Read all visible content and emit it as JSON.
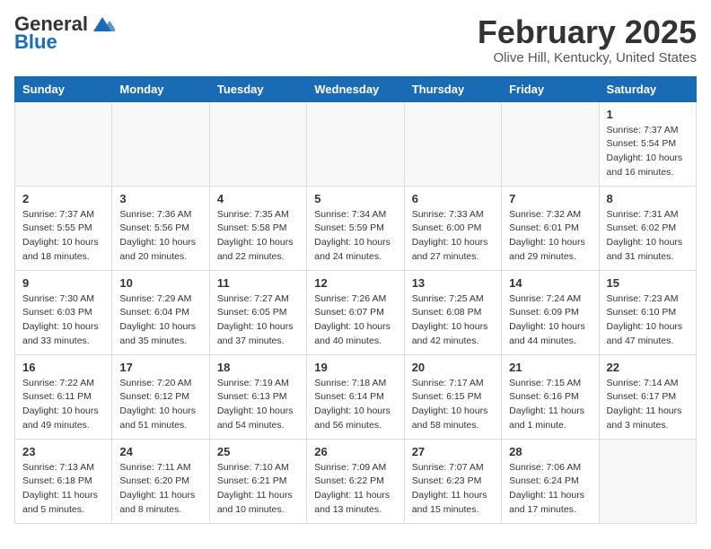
{
  "header": {
    "logo_general": "General",
    "logo_blue": "Blue",
    "month_title": "February 2025",
    "location": "Olive Hill, Kentucky, United States"
  },
  "days_of_week": [
    "Sunday",
    "Monday",
    "Tuesday",
    "Wednesday",
    "Thursday",
    "Friday",
    "Saturday"
  ],
  "weeks": [
    [
      {
        "day": "",
        "info": ""
      },
      {
        "day": "",
        "info": ""
      },
      {
        "day": "",
        "info": ""
      },
      {
        "day": "",
        "info": ""
      },
      {
        "day": "",
        "info": ""
      },
      {
        "day": "",
        "info": ""
      },
      {
        "day": "1",
        "info": "Sunrise: 7:37 AM\nSunset: 5:54 PM\nDaylight: 10 hours\nand 16 minutes."
      }
    ],
    [
      {
        "day": "2",
        "info": "Sunrise: 7:37 AM\nSunset: 5:55 PM\nDaylight: 10 hours\nand 18 minutes."
      },
      {
        "day": "3",
        "info": "Sunrise: 7:36 AM\nSunset: 5:56 PM\nDaylight: 10 hours\nand 20 minutes."
      },
      {
        "day": "4",
        "info": "Sunrise: 7:35 AM\nSunset: 5:58 PM\nDaylight: 10 hours\nand 22 minutes."
      },
      {
        "day": "5",
        "info": "Sunrise: 7:34 AM\nSunset: 5:59 PM\nDaylight: 10 hours\nand 24 minutes."
      },
      {
        "day": "6",
        "info": "Sunrise: 7:33 AM\nSunset: 6:00 PM\nDaylight: 10 hours\nand 27 minutes."
      },
      {
        "day": "7",
        "info": "Sunrise: 7:32 AM\nSunset: 6:01 PM\nDaylight: 10 hours\nand 29 minutes."
      },
      {
        "day": "8",
        "info": "Sunrise: 7:31 AM\nSunset: 6:02 PM\nDaylight: 10 hours\nand 31 minutes."
      }
    ],
    [
      {
        "day": "9",
        "info": "Sunrise: 7:30 AM\nSunset: 6:03 PM\nDaylight: 10 hours\nand 33 minutes."
      },
      {
        "day": "10",
        "info": "Sunrise: 7:29 AM\nSunset: 6:04 PM\nDaylight: 10 hours\nand 35 minutes."
      },
      {
        "day": "11",
        "info": "Sunrise: 7:27 AM\nSunset: 6:05 PM\nDaylight: 10 hours\nand 37 minutes."
      },
      {
        "day": "12",
        "info": "Sunrise: 7:26 AM\nSunset: 6:07 PM\nDaylight: 10 hours\nand 40 minutes."
      },
      {
        "day": "13",
        "info": "Sunrise: 7:25 AM\nSunset: 6:08 PM\nDaylight: 10 hours\nand 42 minutes."
      },
      {
        "day": "14",
        "info": "Sunrise: 7:24 AM\nSunset: 6:09 PM\nDaylight: 10 hours\nand 44 minutes."
      },
      {
        "day": "15",
        "info": "Sunrise: 7:23 AM\nSunset: 6:10 PM\nDaylight: 10 hours\nand 47 minutes."
      }
    ],
    [
      {
        "day": "16",
        "info": "Sunrise: 7:22 AM\nSunset: 6:11 PM\nDaylight: 10 hours\nand 49 minutes."
      },
      {
        "day": "17",
        "info": "Sunrise: 7:20 AM\nSunset: 6:12 PM\nDaylight: 10 hours\nand 51 minutes."
      },
      {
        "day": "18",
        "info": "Sunrise: 7:19 AM\nSunset: 6:13 PM\nDaylight: 10 hours\nand 54 minutes."
      },
      {
        "day": "19",
        "info": "Sunrise: 7:18 AM\nSunset: 6:14 PM\nDaylight: 10 hours\nand 56 minutes."
      },
      {
        "day": "20",
        "info": "Sunrise: 7:17 AM\nSunset: 6:15 PM\nDaylight: 10 hours\nand 58 minutes."
      },
      {
        "day": "21",
        "info": "Sunrise: 7:15 AM\nSunset: 6:16 PM\nDaylight: 11 hours\nand 1 minute."
      },
      {
        "day": "22",
        "info": "Sunrise: 7:14 AM\nSunset: 6:17 PM\nDaylight: 11 hours\nand 3 minutes."
      }
    ],
    [
      {
        "day": "23",
        "info": "Sunrise: 7:13 AM\nSunset: 6:18 PM\nDaylight: 11 hours\nand 5 minutes."
      },
      {
        "day": "24",
        "info": "Sunrise: 7:11 AM\nSunset: 6:20 PM\nDaylight: 11 hours\nand 8 minutes."
      },
      {
        "day": "25",
        "info": "Sunrise: 7:10 AM\nSunset: 6:21 PM\nDaylight: 11 hours\nand 10 minutes."
      },
      {
        "day": "26",
        "info": "Sunrise: 7:09 AM\nSunset: 6:22 PM\nDaylight: 11 hours\nand 13 minutes."
      },
      {
        "day": "27",
        "info": "Sunrise: 7:07 AM\nSunset: 6:23 PM\nDaylight: 11 hours\nand 15 minutes."
      },
      {
        "day": "28",
        "info": "Sunrise: 7:06 AM\nSunset: 6:24 PM\nDaylight: 11 hours\nand 17 minutes."
      },
      {
        "day": "",
        "info": ""
      }
    ]
  ]
}
